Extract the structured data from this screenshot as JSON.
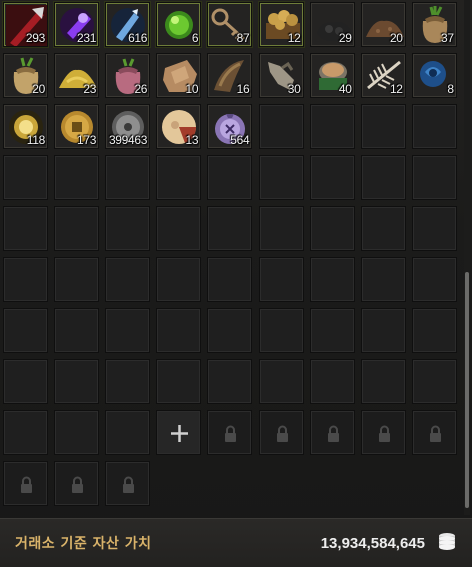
{
  "inventory": {
    "items": [
      {
        "name": "red-tool-icon",
        "qty": "293"
      },
      {
        "name": "purple-crystal-icon",
        "qty": "231"
      },
      {
        "name": "blue-crystal-icon",
        "qty": "616"
      },
      {
        "name": "green-orb-icon",
        "qty": "6"
      },
      {
        "name": "key-icon",
        "qty": "87"
      },
      {
        "name": "potato-crate-icon",
        "qty": "12"
      },
      {
        "name": "coal-icon",
        "qty": "29"
      },
      {
        "name": "soil-pile-icon",
        "qty": "20"
      },
      {
        "name": "seed-sack-icon",
        "qty": "37"
      },
      {
        "name": "grain-sack-icon",
        "qty": "20"
      },
      {
        "name": "yellow-powder-icon",
        "qty": "23"
      },
      {
        "name": "pink-sack-icon",
        "qty": "26"
      },
      {
        "name": "stone-ore-icon",
        "qty": "10"
      },
      {
        "name": "horn-icon",
        "qty": "16"
      },
      {
        "name": "glove-icon",
        "qty": "30"
      },
      {
        "name": "canned-food-icon",
        "qty": "40"
      },
      {
        "name": "fish-bone-icon",
        "qty": "12"
      },
      {
        "name": "blue-rose-icon",
        "qty": "8"
      },
      {
        "name": "gold-orb-icon",
        "qty": "118"
      },
      {
        "name": "gold-coin-icon",
        "qty": "173"
      },
      {
        "name": "silver-coin-icon",
        "qty": "399463"
      },
      {
        "name": "meat-slice-icon",
        "qty": "13"
      },
      {
        "name": "purple-pouch-icon",
        "qty": "564"
      }
    ],
    "green_border_slots": [
      0,
      1,
      2,
      3,
      4,
      5
    ]
  },
  "footer": {
    "label": "거래소 기준 자산 가치",
    "value": "13,934,584,645",
    "coin_icon": "silver-stack-icon"
  },
  "colors": {
    "label_gold": "#d9b36a",
    "value_white": "#eeeeee",
    "green_border": "#6f7d3a"
  }
}
